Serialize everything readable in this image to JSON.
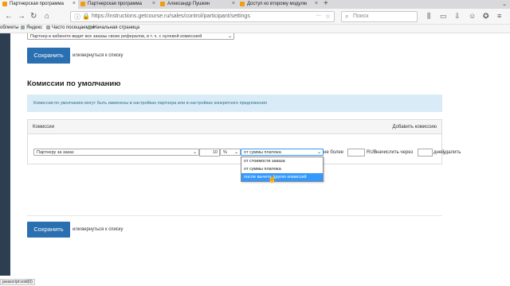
{
  "browser": {
    "tabs": [
      {
        "label": "Партнерская программа",
        "active": true
      },
      {
        "label": "Партнерская программа",
        "active": false
      },
      {
        "label": "Александр Пушкин",
        "active": false
      },
      {
        "label": "Доступ ко второму модулю",
        "active": false
      }
    ],
    "close_glyph": "×",
    "new_tab_glyph": "+",
    "url": "https://instructions.getcourse.ru/sales/control/participant/settings",
    "more_glyph": "···",
    "search_placeholder": "Поиск",
    "bookmarks": [
      {
        "label": "облиеты"
      },
      {
        "label": "Яндекс"
      },
      {
        "label": "Часто посещаемые"
      },
      {
        "label": "Начальная страница"
      }
    ]
  },
  "top_select": {
    "value": "Партнер в кабинете видит все заказы своих рефералов, в т. ч. с нулевой комиссией"
  },
  "top_actions": {
    "save_label": "Сохранить",
    "or_text": "или",
    "back_link": "вернуться к списку"
  },
  "section": {
    "title": "Комиссии по умолчанию",
    "info": "Комиссии по умолчанию могут быть изменены в настройках партнера или в настройках конкретного предложения"
  },
  "commissions": {
    "header_label": "Комиссии",
    "add_link": "Добавить комиссию",
    "row": {
      "type_value": "Партнеру за заказ",
      "amount": "10",
      "unit": "%",
      "base_value": "от суммы платежа",
      "not_more_label": "не более",
      "currency_label": "RUB",
      "accrue_label": "начислить через",
      "days_label": "дней",
      "delete_link": "удалить"
    },
    "base_options": [
      {
        "label": "от стоимости заказа",
        "selected": false
      },
      {
        "label": "от суммы платежа",
        "selected": false
      },
      {
        "label": "после вычета других комиссий",
        "selected": true
      }
    ]
  },
  "bottom_actions": {
    "save_label": "Сохранить",
    "or_text": "или",
    "back_link": "вернуться к списку"
  },
  "status_text": "javascript:void(0)"
}
